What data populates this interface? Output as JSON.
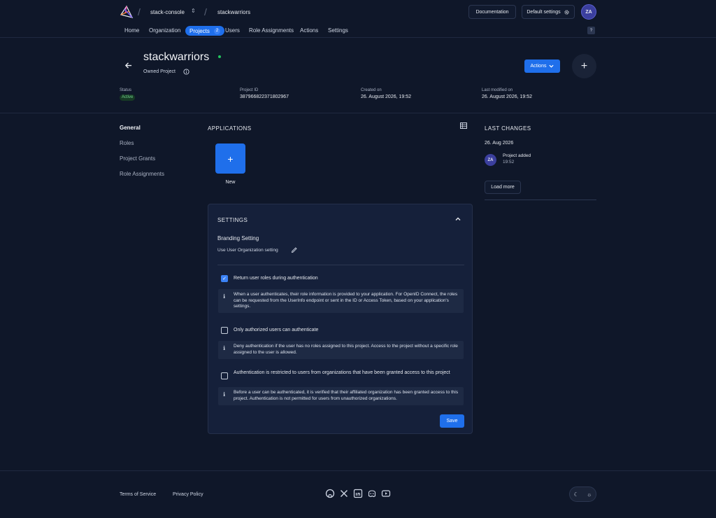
{
  "topbar": {
    "instance": "stack-console",
    "org": "stackwarriors",
    "documentation": "Documentation",
    "default_settings": "Default settings",
    "avatar": "ZA",
    "help": "?"
  },
  "nav": {
    "items": [
      "Home",
      "Organization",
      "Projects",
      "Users",
      "Role Assignments",
      "Actions",
      "Settings"
    ],
    "projects_count": "2"
  },
  "project": {
    "name": "stackwarriors",
    "subtitle": "Owned Project",
    "status_label": "Status",
    "status": "Active",
    "id_label": "Project ID",
    "id": "387966822371802967",
    "created_label": "Created on",
    "created": "26. August 2026, 19:52",
    "modified_label": "Last modified on",
    "modified": "26. August 2026, 19:52",
    "actions_label": "Actions",
    "plus": "+"
  },
  "sidebar": {
    "items": [
      "General",
      "Roles",
      "Project Grants",
      "Role Assignments"
    ]
  },
  "applications": {
    "title": "APPLICATIONS",
    "new_label": "New",
    "plus": "+"
  },
  "settings": {
    "title": "SETTINGS",
    "branding_title": "Branding Setting",
    "branding_value": "Use User Organization setting",
    "option1_label": "Return user roles during authentication",
    "option1_checked": true,
    "option1_info": "When a user authenticates, their role information is provided to your application. For OpenID Connect, the roles can be requested from the UserInfo endpoint or sent in the ID or Access Token, based on your application's settings.",
    "option2_label": "Only authorized users can authenticate",
    "option2_checked": false,
    "option2_info": "Deny authentication if the user has no roles assigned to this project. Access to the project without a specific role assigned to the user is allowed.",
    "option3_label": "Authentication is restricted to users from organizations that have been granted access to this project",
    "option3_checked": false,
    "option3_info": "Before a user can be authenticated, it is verified that their affiliated organization has been granted access to this project. Authentication is not permitted for users from unauthorized organizations.",
    "save": "Save"
  },
  "changes": {
    "title": "LAST CHANGES",
    "date": "26. Aug 2026",
    "avatar": "ZA",
    "event": "Project added",
    "time": "19:52",
    "load_more": "Load more"
  },
  "footer": {
    "terms": "Terms of Service",
    "privacy": "Privacy Policy"
  },
  "colors": {
    "accent": "#1f6feb",
    "background": "#0f1729",
    "card": "#15203a",
    "status_green": "#22c55e"
  }
}
